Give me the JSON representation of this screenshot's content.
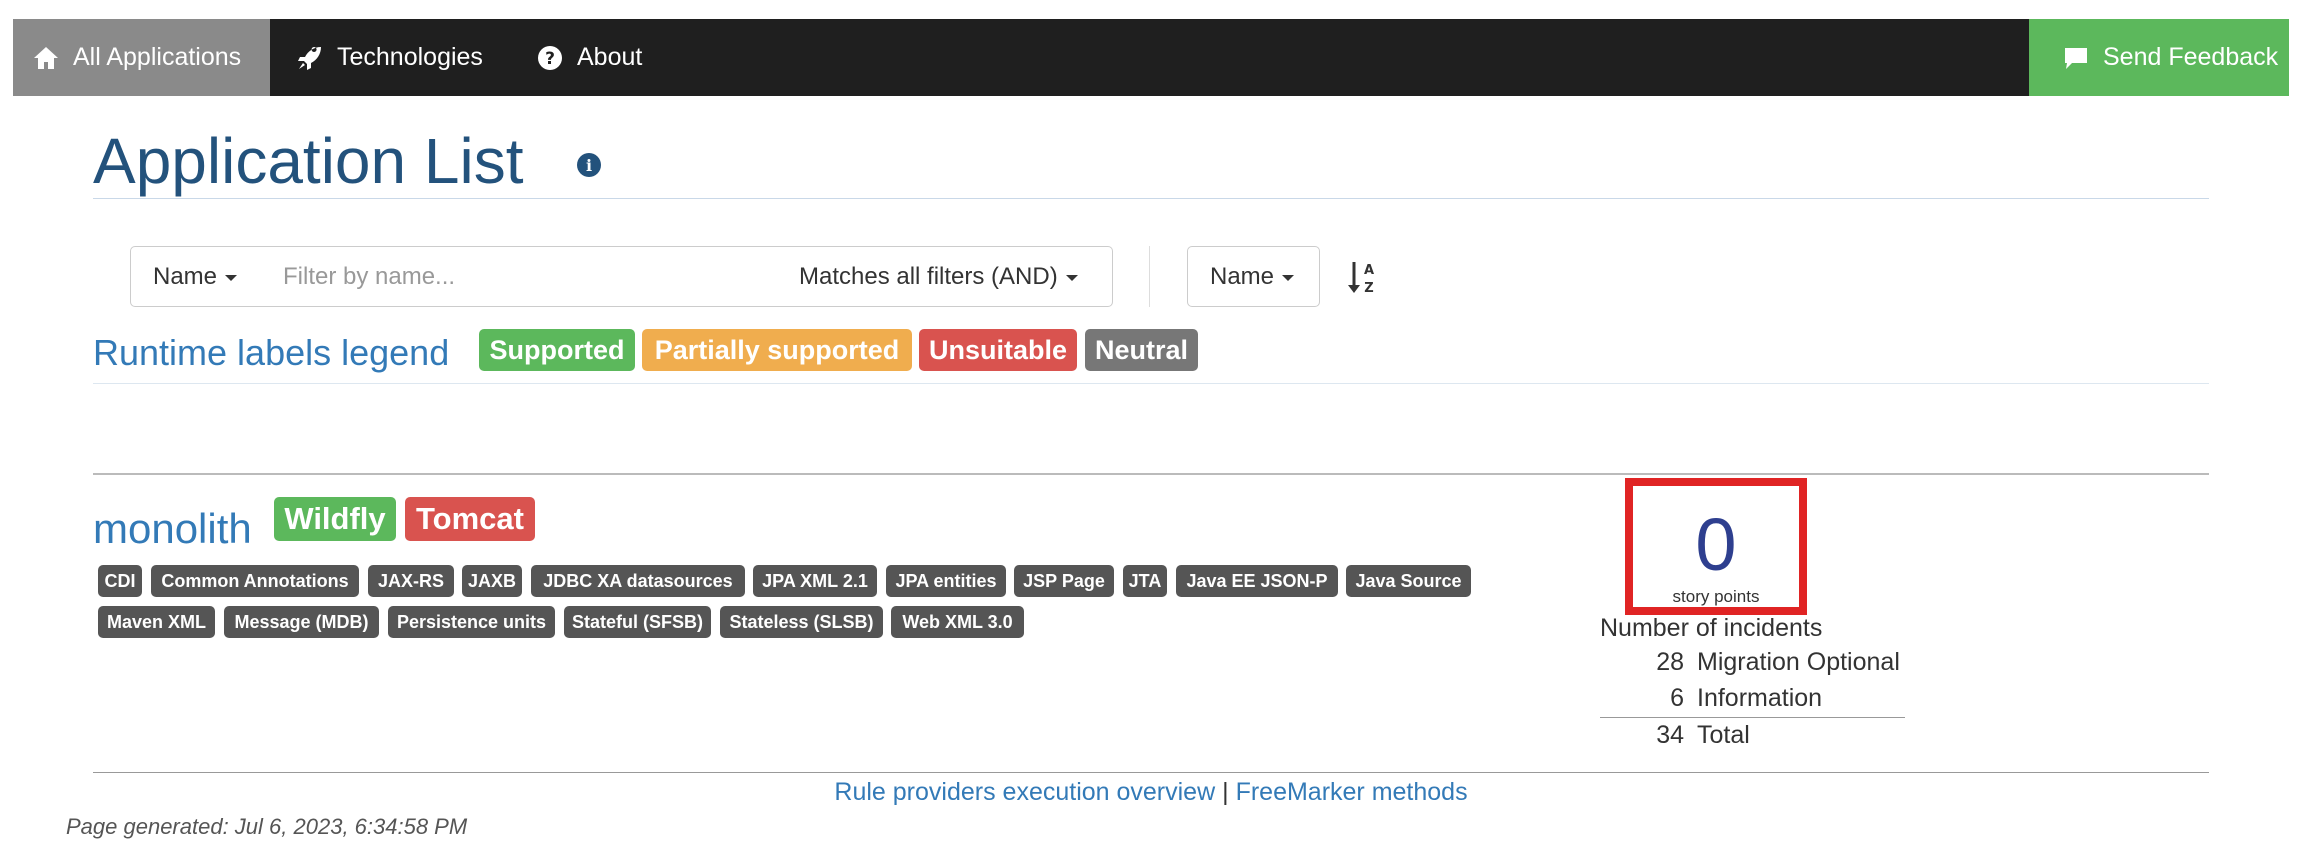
{
  "navbar": {
    "items": [
      {
        "label": "All Applications",
        "icon": "home-icon"
      },
      {
        "label": "Technologies",
        "icon": "rocket-icon"
      },
      {
        "label": "About",
        "icon": "question-circle-icon"
      }
    ],
    "feedback": {
      "label": "Send Feedback",
      "icon": "comment-icon"
    }
  },
  "header": {
    "title": "Application List",
    "info_icon": "i"
  },
  "filters": {
    "field_label": "Name",
    "placeholder": "Filter by name...",
    "match_label": "Matches all filters (AND)",
    "sort_label": "Name",
    "sort_icon": "sort-alpha-asc-icon"
  },
  "legend": {
    "title": "Runtime labels legend",
    "labels": [
      {
        "text": "Supported",
        "color": "#5cb85c"
      },
      {
        "text": "Partially supported",
        "color": "#f0ad4e"
      },
      {
        "text": "Unsuitable",
        "color": "#d9534f"
      },
      {
        "text": "Neutral",
        "color": "#777777"
      }
    ]
  },
  "application": {
    "name": "monolith",
    "runtime_labels": [
      {
        "text": "Wildfly",
        "color": "#5cb85c"
      },
      {
        "text": "Tomcat",
        "color": "#d9534f"
      }
    ],
    "tech_tags": [
      "CDI",
      "Common Annotations",
      "JAX-RS",
      "JAXB",
      "JDBC XA datasources",
      "JPA XML 2.1",
      "JPA entities",
      "JSP Page",
      "JTA",
      "Java EE JSON-P",
      "Java Source",
      "Maven XML",
      "Message (MDB)",
      "Persistence units",
      "Stateful (SFSB)",
      "Stateless (SLSB)",
      "Web XML 3.0"
    ],
    "story_points": {
      "value": "0",
      "label": "story points"
    },
    "incidents": {
      "title": "Number of incidents",
      "rows": [
        {
          "count": "28",
          "label": "Migration Optional"
        },
        {
          "count": "6",
          "label": "Information"
        }
      ],
      "total": {
        "count": "34",
        "label": "Total"
      }
    }
  },
  "footer": {
    "link1": "Rule providers execution overview",
    "separator": "|",
    "link2": "FreeMarker methods",
    "generated": "Page generated: Jul 6, 2023, 6:34:58 PM"
  },
  "colors": {
    "nav_bg": "#1f1f1f",
    "nav_active": "#8a8a8a",
    "feedback": "#5cb85c",
    "title": "#23527c",
    "link": "#337ab7",
    "tag": "#555555",
    "highlight": "#e02424"
  }
}
